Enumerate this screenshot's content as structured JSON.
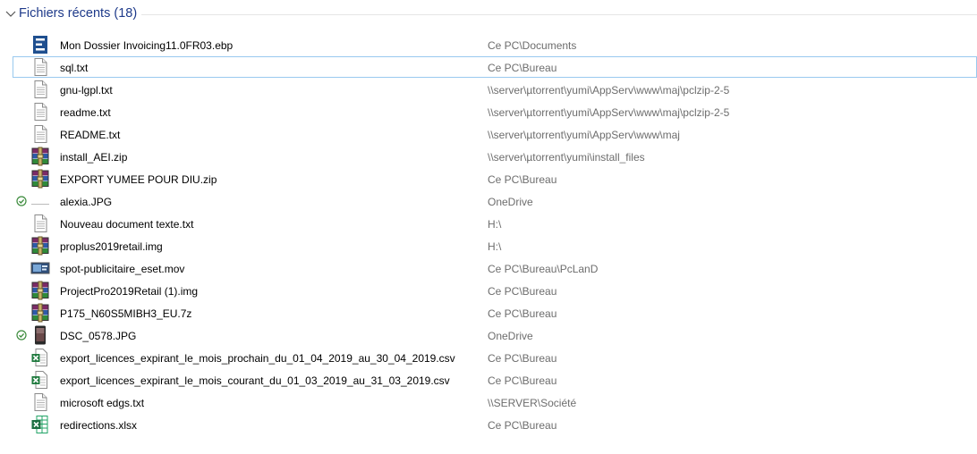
{
  "group": {
    "title": "Fichiers récents (18)",
    "expanded": true
  },
  "files": [
    {
      "name": "Mon Dossier Invoicing11.0FR03.ebp",
      "location": "Ce PC\\Documents",
      "icon": "ebp-icon",
      "status": ""
    },
    {
      "name": "sql.txt",
      "location": "Ce PC\\Bureau",
      "icon": "text-file-icon",
      "status": "",
      "selected": true
    },
    {
      "name": "gnu-lgpl.txt",
      "location": "\\\\server\\µtorrent\\yumi\\AppServ\\www\\maj\\pclzip-2-5",
      "icon": "text-file-icon",
      "status": ""
    },
    {
      "name": "readme.txt",
      "location": "\\\\server\\µtorrent\\yumi\\AppServ\\www\\maj\\pclzip-2-5",
      "icon": "text-file-icon",
      "status": ""
    },
    {
      "name": "README.txt",
      "location": "\\\\server\\µtorrent\\yumi\\AppServ\\www\\maj",
      "icon": "text-file-icon",
      "status": ""
    },
    {
      "name": "install_AEI.zip",
      "location": "\\\\server\\µtorrent\\yumi\\install_files",
      "icon": "winrar-archive-icon",
      "status": ""
    },
    {
      "name": "EXPORT YUMEE POUR DIU.zip",
      "location": "Ce PC\\Bureau",
      "icon": "winrar-archive-icon",
      "status": ""
    },
    {
      "name": "alexia.JPG",
      "location": "OneDrive",
      "icon": "image-thumbnail-icon",
      "status": "synced"
    },
    {
      "name": "Nouveau document texte.txt",
      "location": "H:\\",
      "icon": "text-file-icon",
      "status": ""
    },
    {
      "name": "proplus2019retail.img",
      "location": "H:\\",
      "icon": "winrar-archive-icon",
      "status": ""
    },
    {
      "name": "spot-publicitaire_eset.mov",
      "location": "Ce PC\\Bureau\\PcLanD",
      "icon": "video-thumbnail-icon",
      "status": ""
    },
    {
      "name": "ProjectPro2019Retail (1).img",
      "location": "Ce PC\\Bureau",
      "icon": "winrar-archive-icon",
      "status": ""
    },
    {
      "name": "P175_N60S5MIBH3_EU.7z",
      "location": "Ce PC\\Bureau",
      "icon": "winrar-archive-icon",
      "status": ""
    },
    {
      "name": "DSC_0578.JPG",
      "location": "OneDrive",
      "icon": "phone-photo-icon",
      "status": "synced"
    },
    {
      "name": "export_licences_expirant_le_mois_prochain_du_01_04_2019_au_30_04_2019.csv",
      "location": "Ce PC\\Bureau",
      "icon": "excel-csv-icon",
      "status": ""
    },
    {
      "name": "export_licences_expirant_le_mois_courant_du_01_03_2019_au_31_03_2019.csv",
      "location": "Ce PC\\Bureau",
      "icon": "excel-csv-icon",
      "status": ""
    },
    {
      "name": "microsoft edgs.txt",
      "location": "\\\\SERVER\\Société",
      "icon": "text-file-icon",
      "status": ""
    },
    {
      "name": "redirections.xlsx",
      "location": "Ce PC\\Bureau",
      "icon": "excel-xlsx-icon",
      "status": ""
    }
  ],
  "colors": {
    "group_title": "#1e3a8a",
    "location_text": "#6d6d6d",
    "selection_border": "#99c9ef",
    "sync_green": "#3c8b3c"
  }
}
